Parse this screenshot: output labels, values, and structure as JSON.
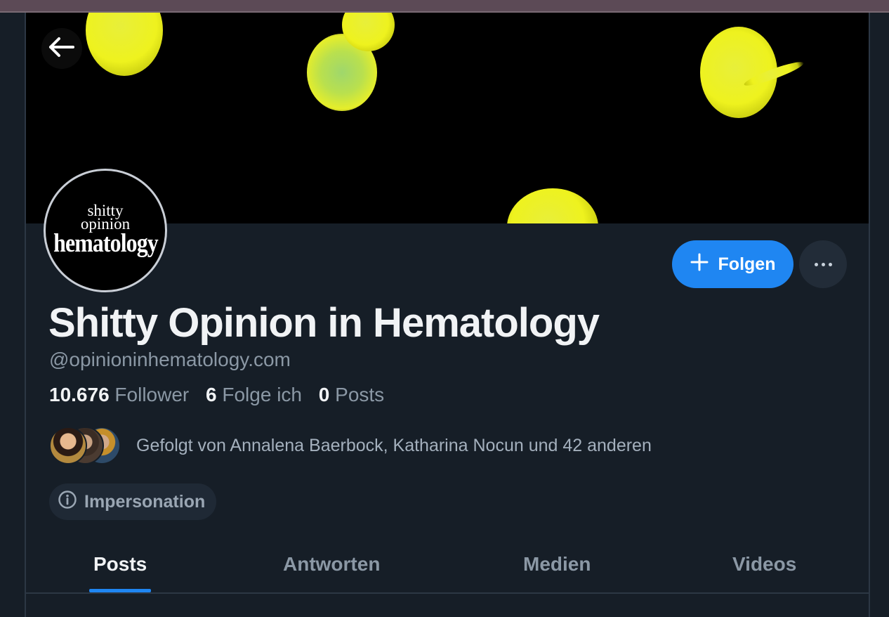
{
  "profile": {
    "avatar_text": {
      "line1": "shitty",
      "line2": "opinion",
      "line3": "hematology"
    },
    "display_name": "Shitty Opinion in Hematology",
    "handle": "@opinioninhematology.com",
    "followers_count": "10.676",
    "followers_label": "Follower",
    "following_count": "6",
    "following_label": "Folge ich",
    "posts_count": "0",
    "posts_label": "Posts",
    "followed_by_text": "Gefolgt von Annalena Baerbock, Katharina Nocun und 42 anderen",
    "label_badge": "Impersonation"
  },
  "actions": {
    "follow_label": "Folgen",
    "back_icon": "arrow-left-icon",
    "more_icon": "ellipsis-icon"
  },
  "tabs": [
    {
      "label": "Posts",
      "active": true
    },
    {
      "label": "Antworten",
      "active": false
    },
    {
      "label": "Medien",
      "active": false
    },
    {
      "label": "Videos",
      "active": false
    }
  ],
  "colors": {
    "background": "#161e27",
    "accent": "#1f86f2",
    "text_primary": "#f1f3f5",
    "text_secondary": "#8b98a5"
  }
}
